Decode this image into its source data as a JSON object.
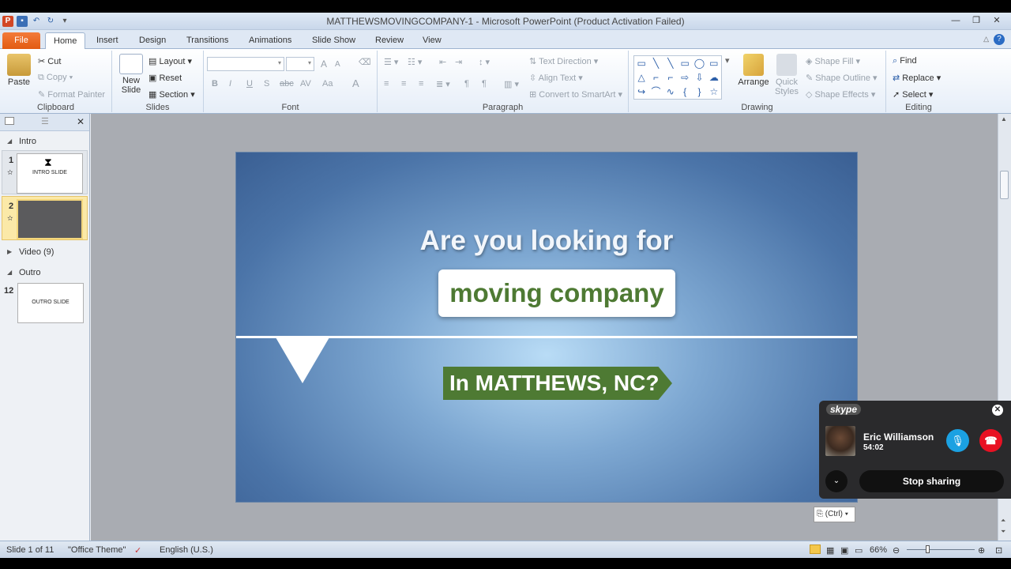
{
  "window": {
    "title": "MATTHEWSMOVINGCOMPANY-1  -  Microsoft PowerPoint (Product Activation Failed)"
  },
  "tabs": [
    {
      "label": "File"
    },
    {
      "label": "Home"
    },
    {
      "label": "Insert"
    },
    {
      "label": "Design"
    },
    {
      "label": "Transitions"
    },
    {
      "label": "Animations"
    },
    {
      "label": "Slide Show"
    },
    {
      "label": "Review"
    },
    {
      "label": "View"
    }
  ],
  "ribbon": {
    "clipboard": {
      "paste": "Paste",
      "cut": "Cut",
      "copy": "Copy",
      "format_painter": "Format Painter",
      "label": "Clipboard"
    },
    "slides": {
      "new_slide": "New",
      "new_slide2": "Slide",
      "layout": "Layout",
      "reset": "Reset",
      "section": "Section",
      "label": "Slides"
    },
    "font": {
      "bold": "B",
      "italic": "I",
      "underline": "U",
      "shadow": "S",
      "strike": "abc",
      "spacing": "AV",
      "case": "Aa",
      "color": "A",
      "grow": "A",
      "shrink": "A",
      "label": "Font"
    },
    "paragraph": {
      "text_direction": "Text Direction",
      "align_text": "Align Text",
      "smartart": "Convert to SmartArt",
      "label": "Paragraph"
    },
    "drawing": {
      "arrange": "Arrange",
      "quick": "Quick",
      "styles": "Styles",
      "fill": "Shape Fill",
      "outline": "Shape Outline",
      "effects": "Shape Effects",
      "label": "Drawing"
    },
    "editing": {
      "find": "Find",
      "replace": "Replace",
      "select": "Select",
      "label": "Editing"
    }
  },
  "slide_panel": {
    "sections": [
      {
        "name": "Intro"
      },
      {
        "name": "Video (9)"
      },
      {
        "name": "Outro"
      }
    ],
    "thumbs": [
      {
        "num": "1",
        "text": "INTRO SLIDE"
      },
      {
        "num": "2",
        "text": ""
      },
      {
        "num": "12",
        "text": "OUTRO SLIDE"
      }
    ]
  },
  "slide": {
    "line1": "Are  you  looking  for",
    "line2": "moving company",
    "line3": "In MATTHEWS, NC?",
    "paste_tag": "(Ctrl)"
  },
  "status": {
    "slide": "Slide 1 of 11",
    "theme": "\"Office Theme\"",
    "language": "English (U.S.)",
    "zoom": "66%"
  },
  "skype": {
    "brand": "skype",
    "caller": "Eric Williamson",
    "duration": "54:02",
    "stop": "Stop sharing"
  },
  "colors": {
    "file_tab": "#e25b12",
    "accent": "#2b5ea8",
    "slide_green": "#4e7a33",
    "skype_blue": "#1ba1e2",
    "hangup_red": "#e81123"
  }
}
